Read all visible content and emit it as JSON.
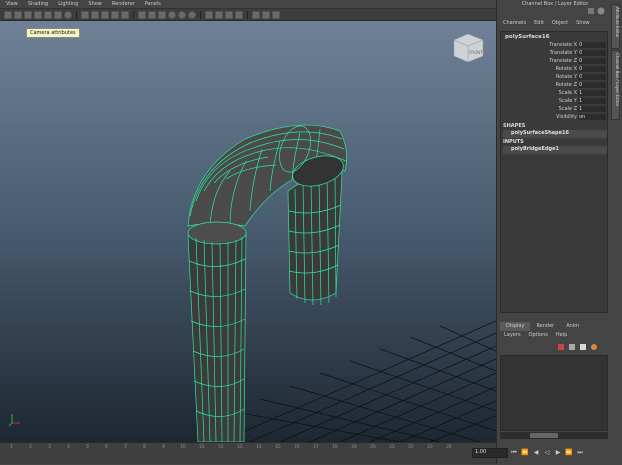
{
  "menu": {
    "items": [
      "View",
      "Shading",
      "Lighting",
      "Show",
      "Renderer",
      "Panels"
    ]
  },
  "viewport": {
    "tooltip": "Camera attributes",
    "viewcube_label": "FRONT"
  },
  "panel": {
    "title": "Channel Box / Layer Editor",
    "tabs": [
      "Channels",
      "Edit",
      "Object",
      "Show"
    ],
    "object_name": "polySurface16",
    "attributes": [
      {
        "label": "Translate X",
        "value": "0"
      },
      {
        "label": "Translate Y",
        "value": "0"
      },
      {
        "label": "Translate Z",
        "value": "0"
      },
      {
        "label": "Rotate X",
        "value": "0"
      },
      {
        "label": "Rotate Y",
        "value": "0"
      },
      {
        "label": "Rotate Z",
        "value": "0"
      },
      {
        "label": "Scale X",
        "value": "1"
      },
      {
        "label": "Scale Y",
        "value": "1"
      },
      {
        "label": "Scale Z",
        "value": "1"
      },
      {
        "label": "Visibility",
        "value": "on"
      }
    ],
    "shapes_heading": "SHAPES",
    "shape_item": "polySurfaceShape16",
    "inputs_heading": "INPUTS",
    "input_item": "polyBridgeEdge1",
    "side_tabs": [
      "Attribute Editor",
      "Channel Box / Layer Editor"
    ]
  },
  "layers": {
    "tabs": [
      "Display",
      "Render",
      "Anim"
    ],
    "menu": [
      "Layers",
      "Options",
      "Help"
    ]
  },
  "timeline": {
    "ticks": [
      "1",
      "2",
      "3",
      "4",
      "5",
      "6",
      "7",
      "8",
      "9",
      "10",
      "11",
      "12",
      "13",
      "14",
      "15",
      "16",
      "17",
      "18",
      "19",
      "20",
      "21",
      "22",
      "23",
      "24"
    ],
    "current_frame": "1.00"
  },
  "colors": {
    "wire": "#2ee6a0",
    "viewport_top": "#6e8196",
    "viewport_bottom": "#1e2731"
  }
}
